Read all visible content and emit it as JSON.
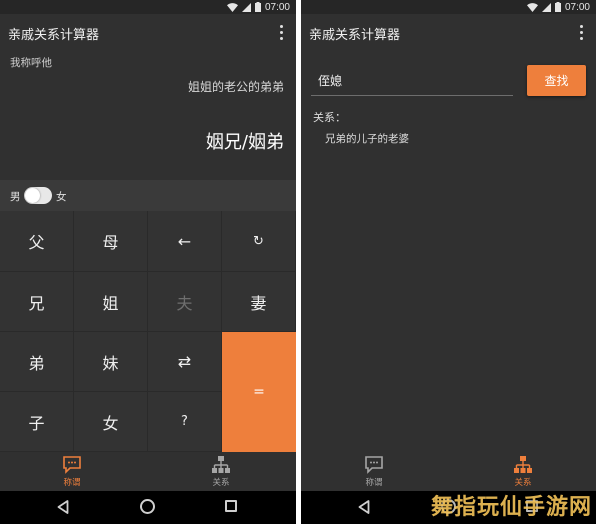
{
  "status_bar": {
    "time": "07:00"
  },
  "app": {
    "title": "亲戚关系计算器"
  },
  "calculator": {
    "caption": "我称呼他",
    "relation_chain": "姐姐的老公的弟弟",
    "result": "姻兄/姻弟",
    "gender": {
      "male": "男",
      "female": "女"
    },
    "keys": {
      "father": "父",
      "mother": "母",
      "backspace": "←",
      "reset": "↻",
      "elder_brother": "兄",
      "elder_sister": "姐",
      "husband": "夫",
      "wife": "妻",
      "younger_brother": "弟",
      "younger_sister": "妹",
      "swap": "⇄",
      "equals": "=",
      "son": "子",
      "daughter": "女",
      "question": "?"
    }
  },
  "search": {
    "input_value": "侄媳",
    "button_label": "查找",
    "relation_label": "关系：",
    "relation_value": "兄弟的儿子的老婆"
  },
  "bottom_nav": {
    "title_tab": "称谓",
    "relation_tab": "关系"
  },
  "watermark": "舞指玩仙手游网",
  "colors": {
    "accent": "#ee7f3c",
    "background": "#303030"
  },
  "icons": [
    "wifi-icon",
    "signal-icon",
    "battery-icon",
    "more-vert-icon",
    "chat-icon",
    "hierarchy-icon",
    "back-icon",
    "home-icon",
    "recents-icon"
  ]
}
